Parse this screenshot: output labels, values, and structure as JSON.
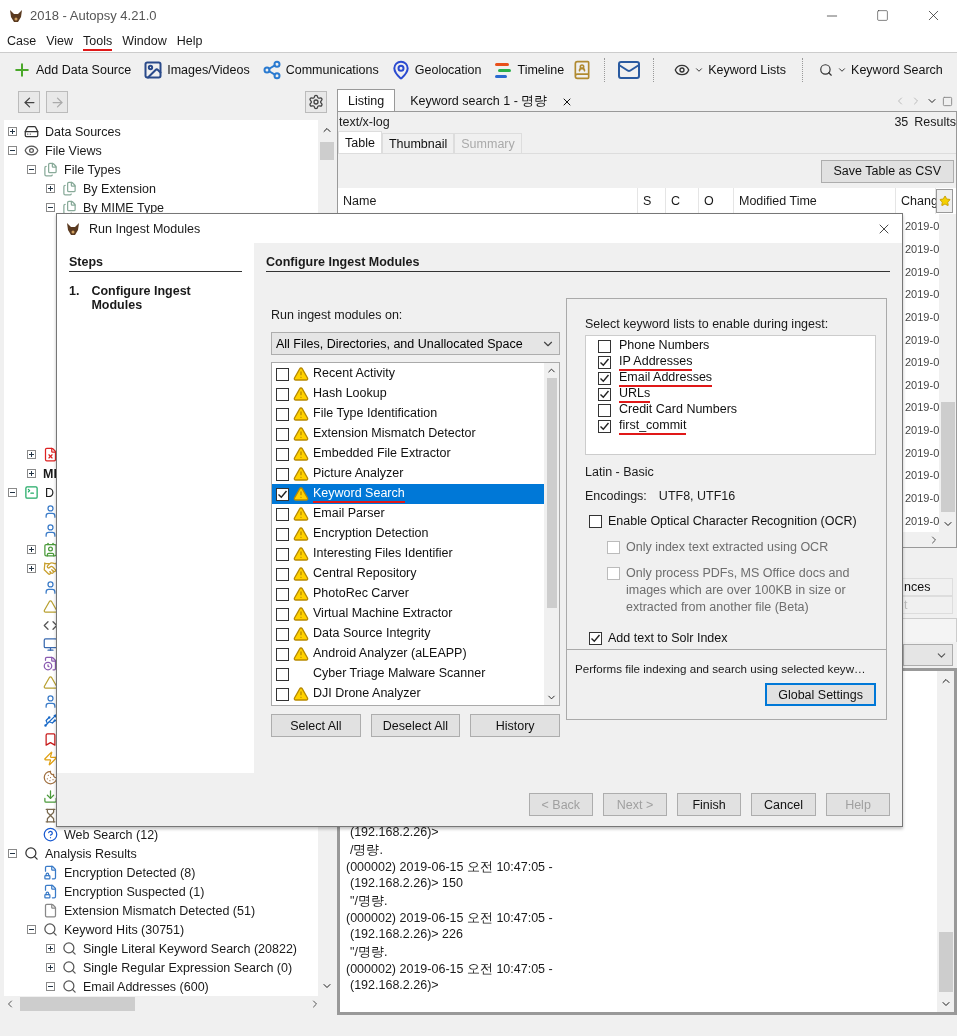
{
  "window": {
    "title": "2018 - Autopsy 4.21.0"
  },
  "menu": [
    {
      "label": "Case",
      "annotated": false
    },
    {
      "label": "View",
      "annotated": false
    },
    {
      "label": "Tools",
      "annotated": true
    },
    {
      "label": "Window",
      "annotated": false
    },
    {
      "label": "Help",
      "annotated": false
    }
  ],
  "toolbar": {
    "buttons": [
      {
        "label": "Add Data Source"
      },
      {
        "label": "Images/Videos"
      },
      {
        "label": "Communications"
      },
      {
        "label": "Geolocation"
      },
      {
        "label": "Timeline"
      }
    ],
    "dropdowns": [
      {
        "label": "Keyword Lists"
      },
      {
        "label": "Keyword Search"
      }
    ]
  },
  "tree": [
    {
      "label": "Data Sources",
      "kind": "collapsed"
    },
    {
      "label": "File Views",
      "kind": "expanded",
      "children": [
        {
          "label": "File Types",
          "kind": "expanded",
          "children": [
            {
              "label": "By Extension",
              "kind": "collapsed"
            },
            {
              "label": "By MIME Type",
              "kind": "expanded"
            }
          ]
        },
        {
          "kind": "collapsed"
        },
        {
          "label": "MI",
          "kind": "collapsed"
        }
      ]
    },
    {
      "label": "D",
      "kind": "expanded",
      "children": [
        {
          "kind": "leaf"
        },
        {
          "kind": "leaf"
        },
        {
          "kind": "collapsed"
        },
        {
          "kind": "collapsed"
        },
        {
          "kind": "leaf"
        },
        {
          "kind": "leaf"
        },
        {
          "kind": "leaf"
        },
        {
          "kind": "leaf"
        },
        {
          "kind": "leaf"
        },
        {
          "kind": "leaf"
        },
        {
          "kind": "leaf"
        },
        {
          "kind": "leaf"
        },
        {
          "kind": "leaf"
        },
        {
          "kind": "leaf"
        },
        {
          "kind": "leaf"
        },
        {
          "kind": "leaf"
        },
        {
          "kind": "leaf"
        },
        {
          "label": "Web Search (12)",
          "kind": "leaf"
        }
      ]
    },
    {
      "label": "Analysis Results",
      "kind": "expanded",
      "children": [
        {
          "label": "Encryption Detected (8)",
          "kind": "leaf"
        },
        {
          "label": "Encryption Suspected (1)",
          "kind": "leaf"
        },
        {
          "label": "Extension Mismatch Detected (51)",
          "kind": "leaf"
        },
        {
          "label": "Keyword Hits (30751)",
          "kind": "expanded",
          "children": [
            {
              "label": "Single Literal Keyword Search (20822)",
              "kind": "collapsed"
            },
            {
              "label": "Single Regular Expression Search (0)",
              "kind": "collapsed"
            },
            {
              "label": "Email Addresses (600)",
              "kind": "expanded"
            }
          ]
        }
      ]
    }
  ],
  "viewer": {
    "tabs": [
      {
        "label": "Listing",
        "selected": true,
        "closable": false
      },
      {
        "label": "Keyword search 1 - 명량",
        "selected": false,
        "closable": true
      }
    ],
    "mime": "text/x-log",
    "count": "35",
    "count_label": "Results",
    "subtabs": [
      {
        "label": "Table",
        "selected": true,
        "disabled": false
      },
      {
        "label": "Thumbnail",
        "selected": false,
        "disabled": false
      },
      {
        "label": "Summary",
        "selected": false,
        "disabled": true
      }
    ],
    "save_button": "Save Table as CSV",
    "columns": [
      "Name",
      "S",
      "C",
      "O",
      "Modified Time",
      "Chang"
    ],
    "cells": [
      "2019-0",
      "2019-0",
      "2019-0",
      "2019-0",
      "2019-0",
      "2019-0",
      "2019-0",
      "2019-0",
      "2019-0",
      "2019-0",
      "2019-0",
      "2019-0",
      "2019-0",
      "2019-0"
    ]
  },
  "lower_panel": {
    "tabs": [
      {
        "label": "nces",
        "disabled": false
      },
      {
        "label": "t",
        "disabled": true
      }
    ],
    "lines": [
      {
        "text": "(192.168.2.26)>",
        "indent": true
      },
      {
        "text": "/명량.",
        "indent": true
      },
      {
        "text": "(000002) 2019-06-15 오전 10:47:05 -",
        "indent": false
      },
      {
        "text": "(192.168.2.26)> 150",
        "indent": true
      },
      {
        "text": "\"/명량.",
        "indent": true
      },
      {
        "text": "(000002) 2019-06-15 오전 10:47:05 -",
        "indent": false
      },
      {
        "text": "(192.168.2.26)> 226",
        "indent": true
      },
      {
        "text": "\"/명량.",
        "indent": true
      },
      {
        "text": "(000002) 2019-06-15 오전 10:47:05 -",
        "indent": false
      },
      {
        "text": "(192.168.2.26)>",
        "indent": true
      }
    ]
  },
  "dialog": {
    "title": "Run Ingest Modules",
    "steps_title": "Steps",
    "steps": [
      {
        "number": "1.",
        "label": "Configure Ingest Modules",
        "selected": true
      }
    ],
    "heading": "Configure Ingest Modules",
    "run_on_label": "Run ingest modules on:",
    "run_on_value": "All Files, Directories, and Unallocated Space",
    "modules": [
      {
        "label": "Recent Activity",
        "checked": false,
        "warning": true,
        "selected": false,
        "annotated": false
      },
      {
        "label": "Hash Lookup",
        "checked": false,
        "warning": true,
        "selected": false,
        "annotated": false
      },
      {
        "label": "File Type Identification",
        "checked": false,
        "warning": true,
        "selected": false,
        "annotated": false
      },
      {
        "label": "Extension Mismatch Detector",
        "checked": false,
        "warning": true,
        "selected": false,
        "annotated": false
      },
      {
        "label": "Embedded File Extractor",
        "checked": false,
        "warning": true,
        "selected": false,
        "annotated": false
      },
      {
        "label": "Picture Analyzer",
        "checked": false,
        "warning": true,
        "selected": false,
        "annotated": false
      },
      {
        "label": "Keyword Search",
        "checked": true,
        "warning": true,
        "selected": true,
        "annotated": true
      },
      {
        "label": "Email Parser",
        "checked": false,
        "warning": true,
        "selected": false,
        "annotated": false
      },
      {
        "label": "Encryption Detection",
        "checked": false,
        "warning": true,
        "selected": false,
        "annotated": false
      },
      {
        "label": "Interesting Files Identifier",
        "checked": false,
        "warning": true,
        "selected": false,
        "annotated": false
      },
      {
        "label": "Central Repository",
        "checked": false,
        "warning": true,
        "selected": false,
        "annotated": false
      },
      {
        "label": "PhotoRec Carver",
        "checked": false,
        "warning": true,
        "selected": false,
        "annotated": false
      },
      {
        "label": "Virtual Machine Extractor",
        "checked": false,
        "warning": true,
        "selected": false,
        "annotated": false
      },
      {
        "label": "Data Source Integrity",
        "checked": false,
        "warning": true,
        "selected": false,
        "annotated": false
      },
      {
        "label": "Android Analyzer (aLEAPP)",
        "checked": false,
        "warning": true,
        "selected": false,
        "annotated": false
      },
      {
        "label": "Cyber Triage Malware Scanner",
        "checked": false,
        "warning": false,
        "selected": false,
        "annotated": false
      },
      {
        "label": "DJI Drone Analyzer",
        "checked": false,
        "warning": true,
        "selected": false,
        "annotated": false
      }
    ],
    "module_buttons": [
      "Select All",
      "Deselect All",
      "History"
    ],
    "keyword_lists_label": "Select keyword lists to enable during ingest:",
    "keyword_lists": [
      {
        "label": "Phone Numbers",
        "checked": false,
        "annotated": false
      },
      {
        "label": "IP Addresses",
        "checked": true,
        "annotated": true
      },
      {
        "label": "Email Addresses",
        "checked": true,
        "annotated": true
      },
      {
        "label": "URLs",
        "checked": true,
        "annotated": true
      },
      {
        "label": "Credit Card Numbers",
        "checked": false,
        "annotated": false
      },
      {
        "label": "first_commit",
        "checked": true,
        "annotated": true
      }
    ],
    "script": "Latin - Basic",
    "encodings_label": "Encodings:",
    "encodings": "UTF8, UTF16",
    "options": [
      {
        "label": "Enable Optical Character Recognition (OCR)",
        "checked": false,
        "disabled": false,
        "kind": "main"
      },
      {
        "label": "Only index text extracted using OCR",
        "checked": false,
        "disabled": true,
        "kind": "sub"
      },
      {
        "label": "Only process PDFs, MS Office docs and images which are over 100KB in size or extracted from another file (Beta)",
        "checked": false,
        "disabled": true,
        "kind": "sub"
      },
      {
        "label": "Add text to Solr Index",
        "checked": true,
        "disabled": false,
        "kind": "main"
      }
    ],
    "description": "Performs file indexing and search using selected keyw…",
    "settings_button": "Global Settings",
    "footer_buttons": [
      {
        "label": "< Back",
        "disabled": true
      },
      {
        "label": "Next >",
        "disabled": true
      },
      {
        "label": "Finish",
        "disabled": false
      },
      {
        "label": "Cancel",
        "disabled": false
      },
      {
        "label": "Help",
        "disabled": true
      }
    ]
  }
}
